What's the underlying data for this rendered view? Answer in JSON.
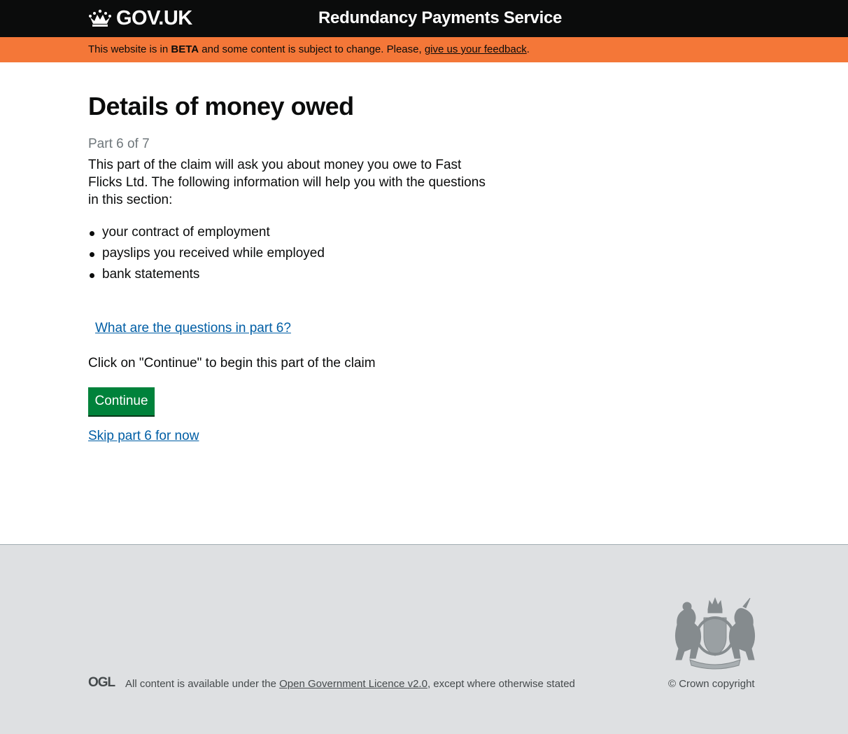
{
  "header": {
    "logo_text": "GOV.UK",
    "service_name": "Redundancy Payments Service"
  },
  "beta_banner": {
    "prefix": "This website is in ",
    "tag": "BETA",
    "middle": " and some content is subject to change. Please, ",
    "feedback_link": "give us your feedback",
    "suffix": "."
  },
  "main": {
    "title": "Details of money owed",
    "caption": "Part 6 of 7",
    "intro": "This part of the claim will ask you about money you owe to Fast Flicks Ltd. The following information will help you with the questions in this section:",
    "bullets": [
      "your contract of employment",
      "payslips you received while employed",
      "bank statements"
    ],
    "details_link": "What are the questions in part 6?",
    "instruction": "Click on \"Continue\" to begin this part of the claim",
    "continue_label": "Continue",
    "skip_link": "Skip part 6 for now"
  },
  "footer": {
    "ogl_logo": "OGL",
    "licence_prefix": "All content is available under the ",
    "licence_link": "Open Government Licence v2.0",
    "licence_suffix": ", except where otherwise stated",
    "copyright": "© Crown copyright",
    "crest_icon": "royal-coat-of-arms-icon"
  },
  "colors": {
    "header_bg": "#0b0c0c",
    "beta_banner_bg": "#f47738",
    "link": "#005ea5",
    "button_green": "#00823b",
    "footer_bg": "#dee0e2",
    "secondary_text": "#6f777b"
  }
}
